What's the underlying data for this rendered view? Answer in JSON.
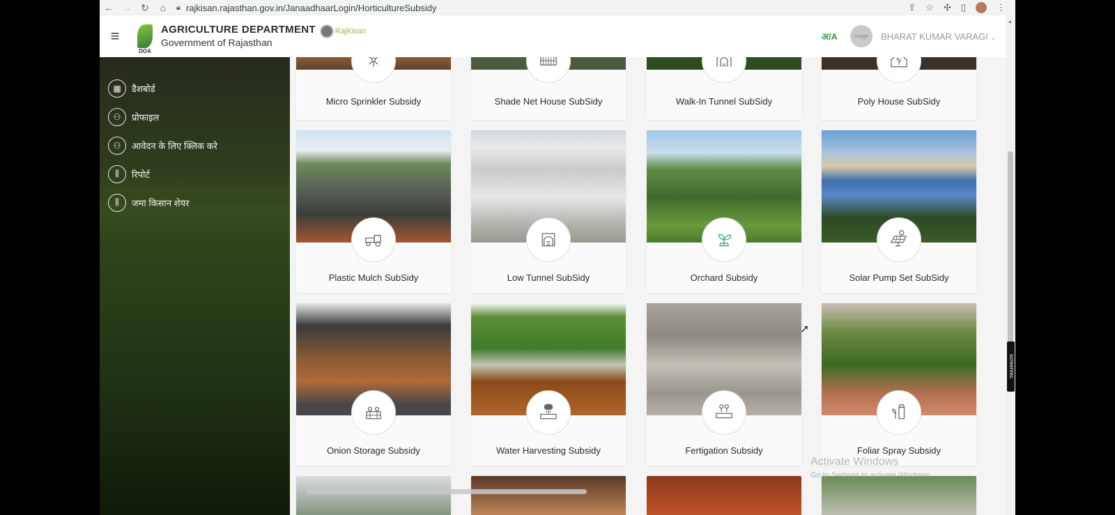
{
  "browser": {
    "url": "rajkisan.rajasthan.gov.in/JanaadhaarLogin/HorticultureSubsidy",
    "icons": [
      "back-icon",
      "forward-icon",
      "reload-icon",
      "home-icon",
      "lock-icon",
      "share-icon",
      "star-icon",
      "extensions-icon",
      "sidepanel-icon",
      "profile-icon",
      "menu-dots-icon"
    ]
  },
  "header": {
    "dept_title": "AGRICULTURE DEPARTMENT",
    "dept_subtitle": "Government of Rajasthan",
    "logo_text": "DOA",
    "rajkisan_label": "RajKisan",
    "lang_toggle": "अ/A",
    "avatar_text": "image",
    "user_name": "BHARAT KUMAR VARAGI"
  },
  "sidebar": {
    "items": [
      {
        "label": "डैशबोर्ड",
        "icon": "dashboard-icon",
        "glyph": "▦"
      },
      {
        "label": "प्रोफाइल",
        "icon": "user-icon",
        "glyph": "⚇"
      },
      {
        "label": "आवेदन के लिए क्लिक करे",
        "icon": "user-icon",
        "glyph": "⚇"
      },
      {
        "label": "रिपोर्ट",
        "icon": "sliders-icon",
        "glyph": "⫼"
      },
      {
        "label": "जमा किसान शेयर",
        "icon": "sliders-icon",
        "glyph": "⫼"
      }
    ]
  },
  "cards": [
    {
      "label": "Micro Sprinkler Subsidy",
      "icon": "sprinkler-icon"
    },
    {
      "label": "Shade Net House SubSidy",
      "icon": "shade-net-icon"
    },
    {
      "label": "Walk-In Tunnel SubSidy",
      "icon": "tunnel-icon"
    },
    {
      "label": "Poly House SubSidy",
      "icon": "poly-house-icon"
    },
    {
      "label": "Plastic Mulch SubSidy",
      "icon": "tractor-icon"
    },
    {
      "label": "Low Tunnel SubSidy",
      "icon": "low-tunnel-icon"
    },
    {
      "label": "Orchard Subsidy",
      "icon": "plant-icon"
    },
    {
      "label": "Solar Pump Set SubSidy",
      "icon": "solar-panel-icon"
    },
    {
      "label": "Onion Storage Subsidy",
      "icon": "storage-crate-icon"
    },
    {
      "label": "Water Harvesting Subsidy",
      "icon": "water-tank-icon"
    },
    {
      "label": "Fertigation Subsidy",
      "icon": "fertigation-icon"
    },
    {
      "label": "Foliar Spray Subsidy",
      "icon": "spray-bottle-icon"
    }
  ],
  "overlay": {
    "activate_title": "Activate Windows",
    "activate_sub": "Go to Settings to activate Windows.",
    "screenrec": "screenrec"
  }
}
